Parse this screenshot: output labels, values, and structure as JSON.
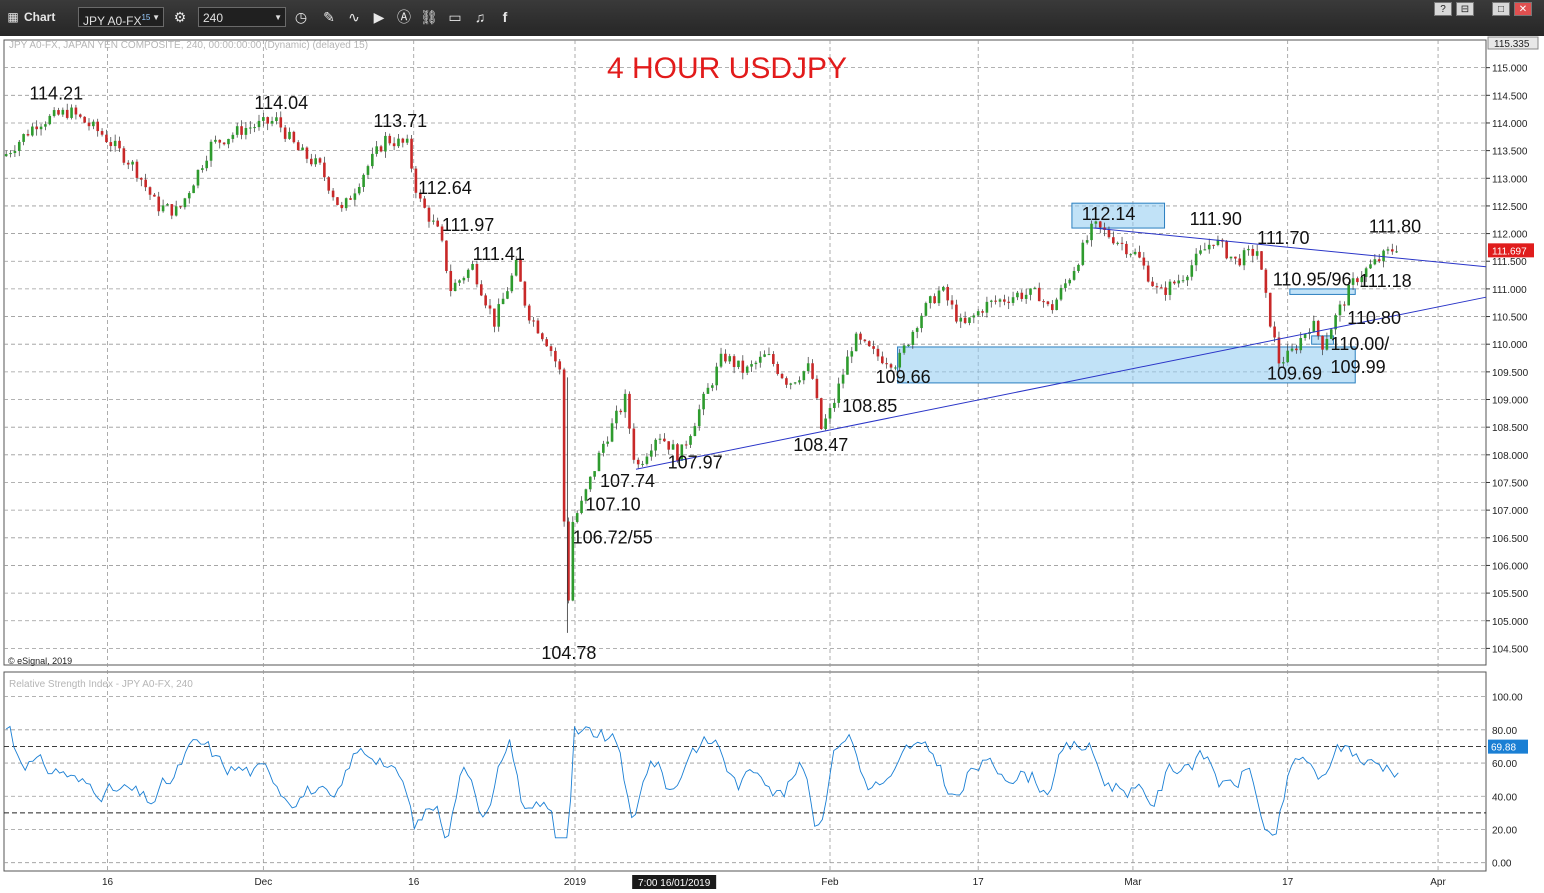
{
  "window": {
    "title": "Chart",
    "symbol": "JPY A0-FX",
    "symbol_sup": "15",
    "interval": "240",
    "buttons": [
      "?",
      "⊟",
      "□",
      "✕"
    ]
  },
  "chart_data": [
    {
      "type": "candlestick",
      "title": "4 HOUR USDJPY",
      "subtitle": "JPY A0-FX, JAPAN YEN COMPOSITE, 240, 00:00:00:00 (Dynamic) (delayed 15)",
      "copyright": "© eSignal, 2019",
      "ylim": [
        104.2,
        115.5
      ],
      "y_ticks": [
        "115.000",
        "114.500",
        "114.000",
        "113.500",
        "113.000",
        "112.500",
        "112.000",
        "111.500",
        "111.000",
        "110.500",
        "110.000",
        "109.500",
        "109.000",
        "108.500",
        "108.000",
        "107.500",
        "107.000",
        "106.500",
        "106.000",
        "105.500",
        "105.000",
        "104.500"
      ],
      "current_top": "115.335",
      "last_price": "111.697",
      "x_labels": [
        "16",
        "Dec",
        "16",
        "2019",
        "Feb",
        "17",
        "Mar",
        "17",
        "Apr"
      ],
      "crosshair_label": "7:00 16/01/2019",
      "price_path": [
        [
          0,
          113.4
        ],
        [
          3,
          114.0
        ],
        [
          6,
          114.21
        ],
        [
          9,
          113.8
        ],
        [
          12,
          113.2
        ],
        [
          14,
          112.5
        ],
        [
          16,
          112.4
        ],
        [
          19,
          113.6
        ],
        [
          22,
          113.9
        ],
        [
          25,
          114.04
        ],
        [
          27,
          113.5
        ],
        [
          29,
          113.2
        ],
        [
          31,
          112.4
        ],
        [
          33,
          113.1
        ],
        [
          35,
          113.71
        ],
        [
          37,
          113.6
        ],
        [
          38,
          112.64
        ],
        [
          40,
          111.97
        ],
        [
          41,
          111.0
        ],
        [
          43,
          111.41
        ],
        [
          45,
          110.4
        ],
        [
          47,
          111.41
        ],
        [
          48,
          110.6
        ],
        [
          50,
          110.0
        ],
        [
          51,
          109.5
        ],
        [
          51.7,
          104.78
        ],
        [
          52,
          106.72
        ],
        [
          53,
          107.1
        ],
        [
          55,
          108.2
        ],
        [
          57,
          109.0
        ],
        [
          58,
          107.74
        ],
        [
          60,
          108.4
        ],
        [
          62,
          107.97
        ],
        [
          64,
          108.9
        ],
        [
          66,
          109.8
        ],
        [
          68,
          109.5
        ],
        [
          70,
          109.8
        ],
        [
          72,
          109.3
        ],
        [
          74,
          109.6
        ],
        [
          75,
          108.47
        ],
        [
          76,
          108.85
        ],
        [
          78,
          110.1
        ],
        [
          80,
          109.8
        ],
        [
          82,
          109.66
        ],
        [
          84,
          110.5
        ],
        [
          86,
          111.0
        ],
        [
          88,
          110.3
        ],
        [
          90,
          110.7
        ],
        [
          93,
          110.9
        ],
        [
          95,
          110.9
        ],
        [
          96,
          110.6
        ],
        [
          98,
          111.3
        ],
        [
          100,
          112.14
        ],
        [
          102,
          111.9
        ],
        [
          104,
          111.6
        ],
        [
          106,
          110.9
        ],
        [
          108,
          111.2
        ],
        [
          111,
          111.9
        ],
        [
          113,
          111.5
        ],
        [
          115,
          111.7
        ],
        [
          116,
          110.6
        ],
        [
          117,
          109.69
        ],
        [
          118,
          109.8
        ],
        [
          120,
          110.4
        ],
        [
          121,
          110.0
        ],
        [
          123,
          110.8
        ],
        [
          124,
          111.18
        ],
        [
          126,
          111.5
        ],
        [
          128,
          111.8
        ]
      ],
      "annotations": [
        {
          "label": "114.21",
          "x": 6,
          "y": 114.21
        },
        {
          "label": "114.04",
          "x": 25,
          "y": 114.04
        },
        {
          "label": "113.71",
          "x": 35,
          "y": 113.71
        },
        {
          "label": "112.64",
          "x": 38,
          "y": 112.64
        },
        {
          "label": "111.97",
          "x": 40,
          "y": 111.97
        },
        {
          "label": "111.41",
          "x": 43,
          "y": 111.41
        },
        {
          "label": "104.78",
          "x": 51.7,
          "y": 104.78
        },
        {
          "label": "106.72/55",
          "x": 52,
          "y": 106.72
        },
        {
          "label": "107.10",
          "x": 53,
          "y": 107.1
        },
        {
          "label": "107.74",
          "x": 58,
          "y": 107.74
        },
        {
          "label": "107.97",
          "x": 62,
          "y": 107.97
        },
        {
          "label": "108.47",
          "x": 75,
          "y": 108.47
        },
        {
          "label": "108.85",
          "x": 76,
          "y": 108.85
        },
        {
          "label": "109.66",
          "x": 82,
          "y": 109.66
        },
        {
          "label": "112.14",
          "x": 100,
          "y": 112.14
        },
        {
          "label": "111.90",
          "x": 111,
          "y": 111.9
        },
        {
          "label": "111.70",
          "x": 115,
          "y": 111.7
        },
        {
          "label": "110.95/96",
          "x": 119,
          "y": 110.95
        },
        {
          "label": "109.69",
          "x": 117,
          "y": 109.69
        },
        {
          "label": "111.18",
          "x": 124,
          "y": 111.18
        },
        {
          "label": "110.80",
          "x": 124,
          "y": 110.8
        },
        {
          "label": "110.00/",
          "x": 121,
          "y": 110.0
        },
        {
          "label": "109.99",
          "x": 121,
          "y": 109.99
        },
        {
          "label": "111.80",
          "x": 128,
          "y": 111.8
        }
      ],
      "trendlines": [
        {
          "from": [
            58,
            107.74
          ],
          "to": [
            136,
            110.85
          ]
        },
        {
          "from": [
            100,
            112.1
          ],
          "to": [
            136,
            111.4
          ]
        }
      ],
      "zones": [
        {
          "x": [
            82,
            124
          ],
          "y": [
            109.3,
            109.95
          ]
        },
        {
          "x": [
            98,
            106.5
          ],
          "y": [
            112.1,
            112.55
          ]
        },
        {
          "x": [
            118,
            124
          ],
          "y": [
            110.9,
            111.0
          ]
        },
        {
          "x": [
            120,
            122
          ],
          "y": [
            110.0,
            110.15
          ]
        }
      ],
      "grid": true
    },
    {
      "type": "line",
      "title": "Relative Strength Index - JPY A0-FX, 240",
      "ylim": [
        -5,
        110
      ],
      "y_ticks": [
        "100.00",
        "80.00",
        "60.00",
        "40.00",
        "20.00",
        "0.00"
      ],
      "last_value": "69.88",
      "dashed_levels": [
        70,
        30
      ],
      "color": "#1a7fd4"
    }
  ]
}
